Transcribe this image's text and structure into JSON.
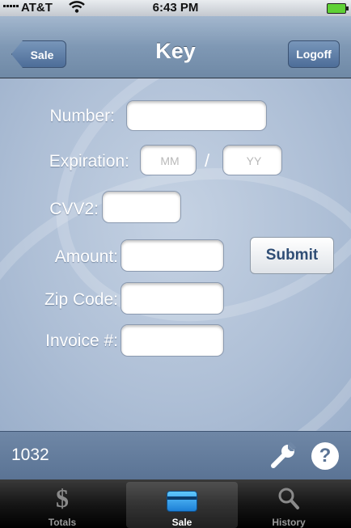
{
  "status_bar": {
    "carrier": "AT&T",
    "time": "6:43 PM"
  },
  "nav": {
    "back_label": "Sale",
    "title": "Key",
    "logoff_label": "Logoff"
  },
  "form": {
    "number_label": "Number:",
    "number_value": "",
    "expiration_label": "Expiration:",
    "month_placeholder": "MM",
    "separator": "/",
    "year_placeholder": "YY",
    "cvv_label": "CVV2:",
    "cvv_value": "",
    "amount_label": "Amount:",
    "amount_value": "",
    "submit_label": "Submit",
    "zip_label": "Zip Code:",
    "zip_value": "",
    "invoice_label": "Invoice #:",
    "invoice_value": ""
  },
  "info_bar": {
    "terminal_id": "1032",
    "wrench_icon": "wrench-icon",
    "help_icon": "help-icon",
    "help_glyph": "?"
  },
  "tabs": [
    {
      "label": "Totals",
      "icon": "dollar-icon",
      "glyph": "$",
      "active": false
    },
    {
      "label": "Sale",
      "icon": "credit-card-icon",
      "active": true
    },
    {
      "label": "History",
      "icon": "search-icon",
      "active": false
    }
  ],
  "colors": {
    "nav_bar": "#7f98b4",
    "form_background": "#aebfd6",
    "info_bar": "#6f87a6",
    "submit_text": "#2f4d75",
    "tab_bar": "#161616"
  }
}
